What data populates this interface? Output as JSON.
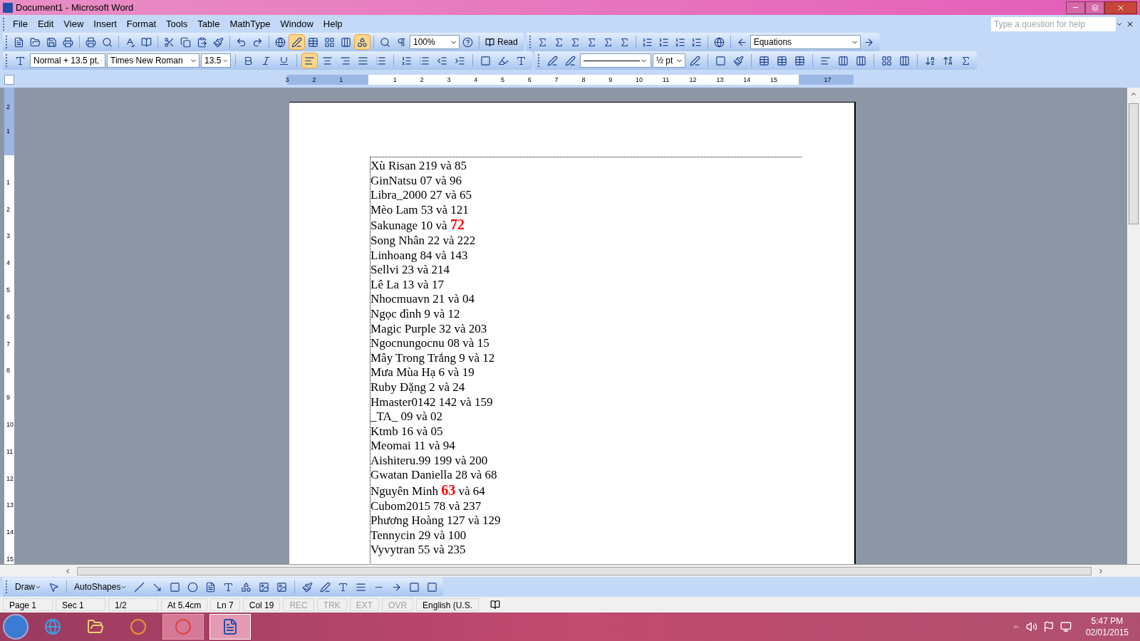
{
  "window": {
    "title": "Document1 - Microsoft Word"
  },
  "menu": [
    "File",
    "Edit",
    "View",
    "Insert",
    "Format",
    "Tools",
    "Table",
    "MathType",
    "Window",
    "Help"
  ],
  "help_box": {
    "placeholder": "Type a question for help"
  },
  "standard_toolbar": {
    "zoom": "100%",
    "read": "Read",
    "equations": "Equations"
  },
  "formatting_toolbar": {
    "style": "Normal + 13.5 pt,",
    "font": "Times New Roman",
    "size": "13.5",
    "line_weight": "½ pt"
  },
  "horizontal_ruler": {
    "left_labels": [
      "3",
      "2",
      "1"
    ],
    "right_labels": [
      "1",
      "2",
      "3",
      "4",
      "5",
      "6",
      "7",
      "8",
      "9",
      "10",
      "11",
      "12",
      "13",
      "14",
      "15",
      "17"
    ]
  },
  "vertical_ruler": {
    "top_labels": [
      "2",
      "1"
    ],
    "labels": [
      "1",
      "2",
      "3",
      "4",
      "5",
      "6",
      "7",
      "8",
      "9",
      "10",
      "11",
      "12",
      "13",
      "14",
      "15"
    ]
  },
  "document": {
    "lines": [
      [
        {
          "text": "Xù Risan 219 và 85",
          "highlight": false
        }
      ],
      [
        {
          "text": "GinNatsu 07 và 96",
          "highlight": false
        }
      ],
      [
        {
          "text": "Libra_2000 27 và 65",
          "highlight": false
        }
      ],
      [
        {
          "text": "Mèo Lam 53 và 121",
          "highlight": false
        }
      ],
      [
        {
          "text": "Sakunage 10 và ",
          "highlight": false
        },
        {
          "text": "72",
          "highlight": true
        }
      ],
      [
        {
          "text": "Song Nhân 22 và 222",
          "highlight": false
        }
      ],
      [
        {
          "text": "Linhoang 84 và 143",
          "highlight": false
        }
      ],
      [
        {
          "text": "Sellvi 23 và 214",
          "highlight": false
        }
      ],
      [
        {
          "text": "Lê La 13 và 17",
          "highlight": false
        }
      ],
      [
        {
          "text": "Nhocmuavn 21 và 04",
          "highlight": false
        }
      ],
      [
        {
          "text": "Ngọc đình 9 và 12",
          "highlight": false
        }
      ],
      [
        {
          "text": "Magic Purple 32 và 203",
          "highlight": false
        }
      ],
      [
        {
          "text": "Ngocnungocnu 08 và 15",
          "highlight": false
        }
      ],
      [
        {
          "text": "Mây Trong Trắng 9 và 12",
          "highlight": false
        }
      ],
      [
        {
          "text": "Mưa Mùa Hạ 6 và 19",
          "highlight": false
        }
      ],
      [
        {
          "text": "Ruby Đặng 2 và 24",
          "highlight": false
        }
      ],
      [
        {
          "text": "Hmaster0142 142 và 159",
          "highlight": false
        }
      ],
      [
        {
          "text": "_TA_ 09 và 02",
          "highlight": false
        }
      ],
      [
        {
          "text": "Ktmb 16 và 05",
          "highlight": false
        }
      ],
      [
        {
          "text": "Meomai 11 và 94",
          "highlight": false
        }
      ],
      [
        {
          "text": "Aishiteru.99 199 và 200",
          "highlight": false
        }
      ],
      [
        {
          "text": "Gwatan Daniella 28 và 68",
          "highlight": false
        }
      ],
      [
        {
          "text": "Nguyên Minh ",
          "highlight": false
        },
        {
          "text": "63",
          "highlight": true
        },
        {
          "text": " và 64",
          "highlight": false
        }
      ],
      [
        {
          "text": "Cubom2015 78 và 237",
          "highlight": false
        }
      ],
      [
        {
          "text": "Phương Hoàng 127 và 129",
          "highlight": false
        }
      ],
      [
        {
          "text": "Tennycin 29 và 100",
          "highlight": false
        }
      ],
      [
        {
          "text": "Vyvytran 55 và 235",
          "highlight": false
        }
      ]
    ]
  },
  "drawing_toolbar": {
    "draw": "Draw",
    "autoshapes": "AutoShapes"
  },
  "status_bar": [
    {
      "text": "Page 1",
      "disabled": false
    },
    {
      "text": "Sec 1",
      "disabled": false
    },
    {
      "text": "1/2",
      "disabled": false
    },
    {
      "text": "At 5.4cm",
      "disabled": false
    },
    {
      "text": "Ln 7",
      "disabled": false
    },
    {
      "text": "Col 19",
      "disabled": false
    },
    {
      "text": "REC",
      "disabled": true
    },
    {
      "text": "TRK",
      "disabled": true
    },
    {
      "text": "EXT",
      "disabled": true
    },
    {
      "text": "OVR",
      "disabled": true
    },
    {
      "text": "English (U.S.",
      "disabled": false
    }
  ],
  "taskbar": {
    "time": "5:47 PM",
    "date": "02/01/2015"
  }
}
